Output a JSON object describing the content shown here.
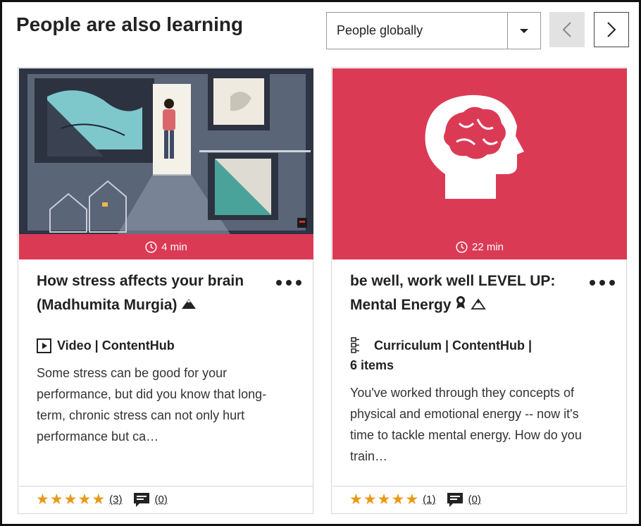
{
  "header": {
    "title": "People are also learning",
    "scope_select": {
      "value": "People globally"
    }
  },
  "colors": {
    "accent": "#db3a55",
    "star": "#e89a16"
  },
  "cards": [
    {
      "duration": "4 min",
      "title": "How stress affects your brain (Madhumita Murgia)",
      "type": "Video | ContentHub",
      "type_extra": "",
      "description": "Some stress can be good for your performance, but did you know that long-term, chronic stress can not only hurt performance but ca…",
      "rating_stars": 5,
      "rating_count": "(3)",
      "comment_count": "(0)",
      "icons": [
        "clock-icon",
        "mountain-icon",
        "video-icon",
        "more-icon",
        "comment-icon"
      ]
    },
    {
      "duration": "22 min",
      "title": "be well, work well LEVEL UP: Mental Energy",
      "type": "Curriculum | ContentHub |",
      "type_extra": "6 items",
      "description": "You've worked through they concepts of physical and emotional energy -- now it's time to tackle mental energy. How do you train…",
      "rating_stars": 5,
      "rating_count": "(1)",
      "comment_count": "(0)",
      "icons": [
        "clock-icon",
        "award-icon",
        "mountain-outline-icon",
        "curriculum-icon",
        "more-icon",
        "comment-icon"
      ]
    }
  ]
}
